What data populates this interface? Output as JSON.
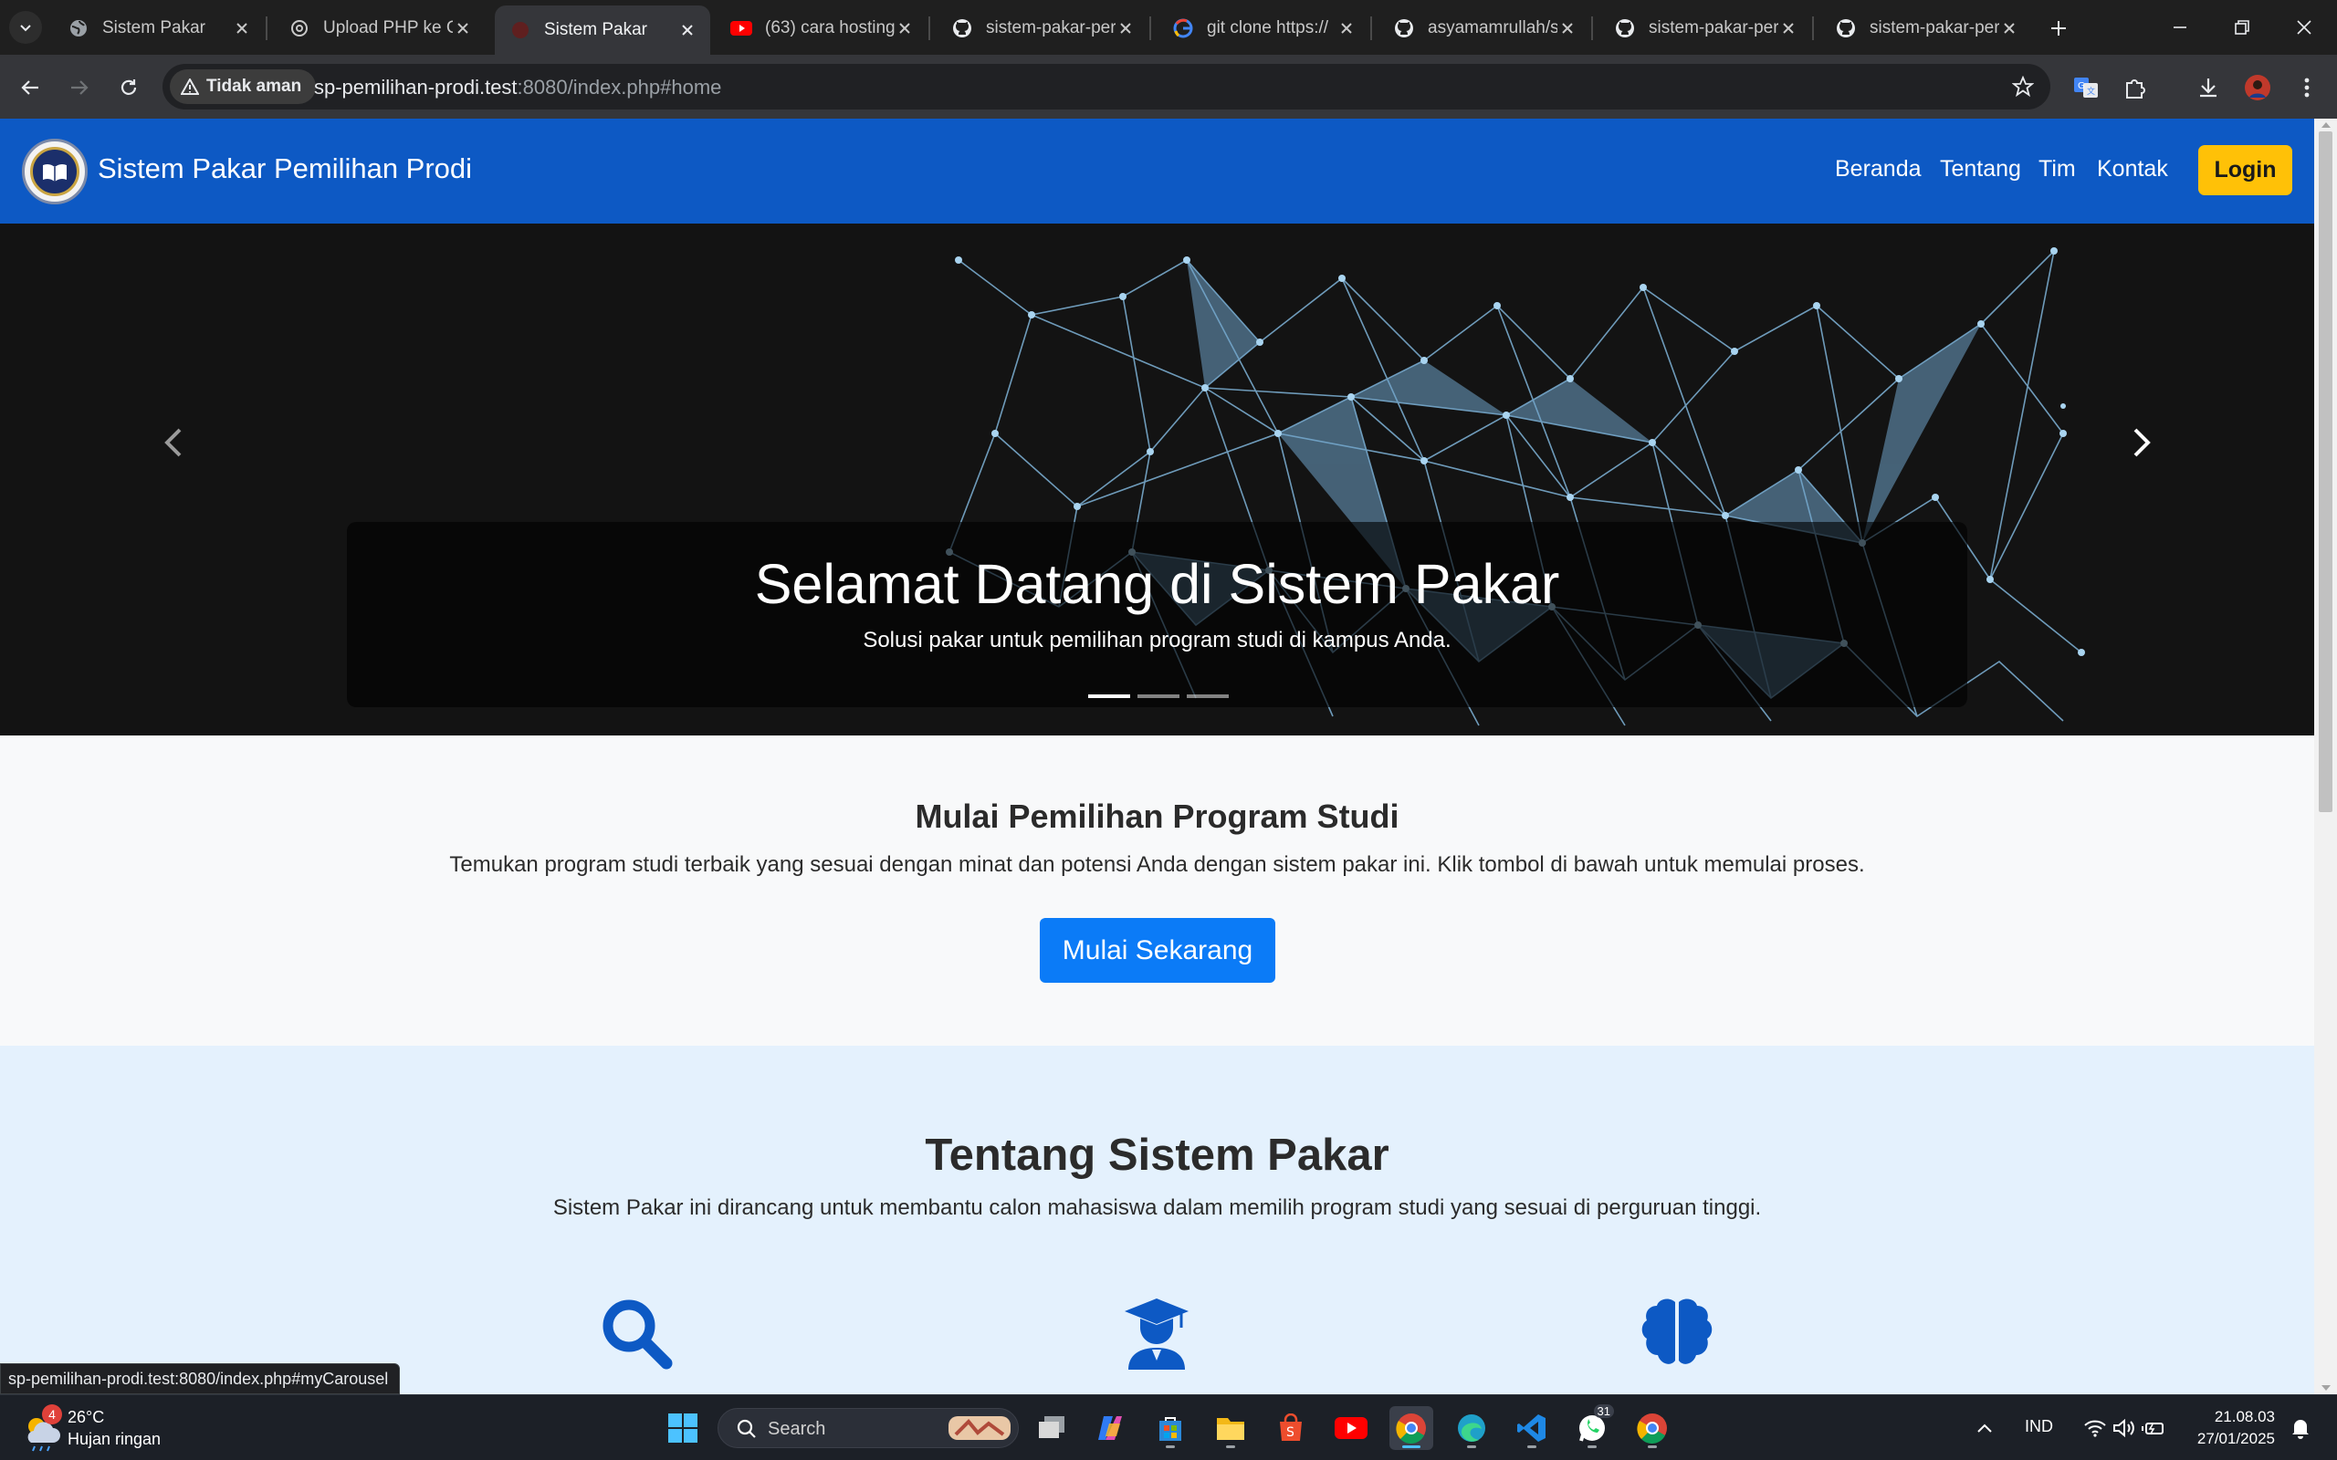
{
  "browser": {
    "tabs": [
      {
        "title": "Sistem Pakar",
        "favicon": "globe-icon",
        "active": false
      },
      {
        "title": "Upload PHP ke G",
        "favicon": "chatgpt-icon",
        "active": false
      },
      {
        "title": "Sistem Pakar",
        "favicon": "globe-icon",
        "active": true
      },
      {
        "title": "(63) cara hosting",
        "favicon": "youtube-icon",
        "active": false
      },
      {
        "title": "sistem-pakar-per",
        "favicon": "github-icon",
        "active": false
      },
      {
        "title": "git clone https://",
        "favicon": "google-icon",
        "active": false
      },
      {
        "title": "asyamamrullah/s",
        "favicon": "github-icon",
        "active": false
      },
      {
        "title": "sistem-pakar-per",
        "favicon": "github-icon",
        "active": false
      },
      {
        "title": "sistem-pakar-per",
        "favicon": "github-icon",
        "active": false
      }
    ],
    "security_label": "Tidak aman",
    "url_host": "sp-pemilihan-prodi.test",
    "url_rest": ":8080/index.php#home",
    "status_url": "sp-pemilihan-prodi.test:8080/index.php#myCarousel"
  },
  "page": {
    "brand": "Sistem Pakar Pemilihan Prodi",
    "nav": [
      "Beranda",
      "Tentang",
      "Tim",
      "Kontak"
    ],
    "login_label": "Login",
    "carousel": {
      "title": "Selamat Datang di Sistem Pakar",
      "subtitle": "Solusi pakar untuk pemilihan program studi di kampus Anda.",
      "slide_count": 3,
      "active_slide": 1
    },
    "start": {
      "heading": "Mulai Pemilihan Program Studi",
      "text": "Temukan program studi terbaik yang sesuai dengan minat dan potensi Anda dengan sistem pakar ini. Klik tombol di bawah untuk memulai proses.",
      "button": "Mulai Sekarang"
    },
    "about": {
      "heading": "Tentang Sistem Pakar",
      "text": "Sistem Pakar ini dirancang untuk membantu calon mahasiswa dalam memilih program studi yang sesuai di perguruan tinggi.",
      "icons": [
        "search-icon",
        "graduate-icon",
        "brain-icon"
      ]
    }
  },
  "taskbar": {
    "weather": {
      "temp": "26°C",
      "condition": "Hujan ringan",
      "badge": "4"
    },
    "search_label": "Search",
    "whatsapp_badge": "31",
    "lang": "IND",
    "time": "21.08.03",
    "date": "27/01/2025"
  },
  "colors": {
    "navbar": "#0d59c4",
    "login": "#ffc107",
    "cta": "#0b7bf7",
    "about_bg": "#e4f1fd",
    "icon_blue": "#0d59c4"
  }
}
